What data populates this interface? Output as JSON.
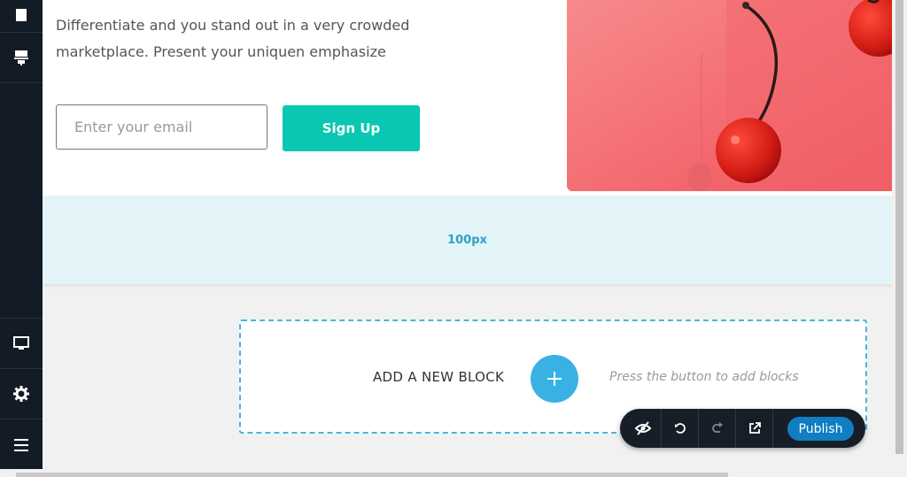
{
  "sidebar": {
    "items": [
      {
        "name": "layers-icon"
      },
      {
        "name": "blocks-icon"
      },
      {
        "name": "desktop-icon"
      },
      {
        "name": "gear-icon"
      },
      {
        "name": "menu-icon"
      }
    ]
  },
  "hero": {
    "line1": "Differentiate and you stand out in a very crowded",
    "line2": "marketplace. Present your uniquen emphasize",
    "email_placeholder": "Enter your email",
    "signup_label": "Sign Up"
  },
  "spacer": {
    "label": "100px"
  },
  "add_block": {
    "label": "ADD A NEW BLOCK",
    "hint": "Press the button to add blocks"
  },
  "toolbar": {
    "publish_label": "Publish",
    "icons": [
      "hide-icon",
      "undo-icon",
      "redo-icon",
      "external-link-icon"
    ]
  },
  "colors": {
    "sidebar": "#131b26",
    "signup": "#09c7b2",
    "spacer_bg": "#e3f4f9",
    "add_button": "#39b2e3",
    "publish": "#0f7ec2"
  }
}
